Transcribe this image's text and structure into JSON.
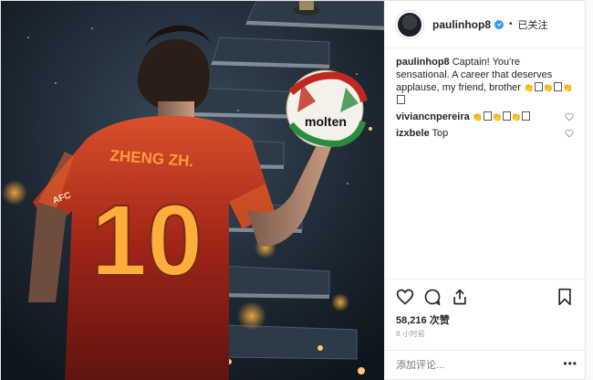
{
  "header": {
    "username": "paulinhop8",
    "follow_status": "已关注"
  },
  "caption": {
    "username": "paulinhop8",
    "text": "Captain! You're sensational. A career that deserves applause, my friend, brother"
  },
  "comments": [
    {
      "username": "viviancnpereira",
      "text": ""
    },
    {
      "username": "izxbele",
      "text": "Top"
    }
  ],
  "stats": {
    "likes": "58,216 次赞",
    "time_ago": "8 小时前"
  },
  "composer": {
    "placeholder": "添加评论..."
  },
  "media": {
    "jersey_name": "ZHENG ZH.",
    "jersey_number": "10",
    "ball_brand": "molten",
    "badge_text": "AFC"
  },
  "icons": {
    "like": "heart-icon",
    "comment": "comment-icon",
    "share": "share-icon",
    "save": "bookmark-icon",
    "verified": "verified-badge-icon"
  },
  "colors": {
    "link": "#262626",
    "verified": "#3897f0",
    "muted": "#999999",
    "border": "#efefef"
  }
}
